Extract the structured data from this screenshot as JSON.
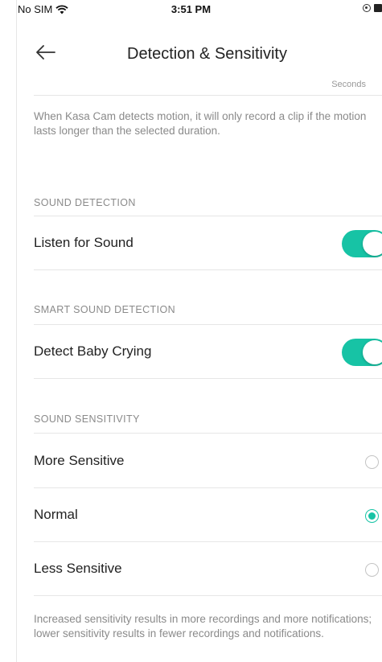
{
  "status_bar": {
    "carrier": "No SIM",
    "time": "3:51 PM",
    "wifi_icon": "wifi-icon",
    "lock_icon": "orientation-lock-icon",
    "battery_icon": "battery-icon"
  },
  "nav": {
    "back_icon": "back-arrow-icon",
    "title": "Detection & Sensitivity"
  },
  "motion_duration": {
    "unit_label": "Seconds",
    "description": "When Kasa Cam detects motion, it will only record a clip if the motion lasts longer than the selected duration."
  },
  "sound_detection": {
    "header": "SOUND DETECTION",
    "label": "Listen for Sound",
    "enabled": true
  },
  "smart_sound_detection": {
    "header": "SMART SOUND DETECTION",
    "label": "Detect Baby Crying",
    "enabled": true
  },
  "sound_sensitivity": {
    "header": "SOUND SENSITIVITY",
    "options": [
      {
        "label": "More Sensitive",
        "selected": false
      },
      {
        "label": "Normal",
        "selected": true
      },
      {
        "label": "Less Sensitive",
        "selected": false
      }
    ],
    "note": "Increased sensitivity results in more recordings and more notifications; lower sensitivity results in fewer recordings and notifications."
  },
  "colors": {
    "accent": "#17c3a5",
    "text": "#222222",
    "muted": "#8a8a8a",
    "divider": "#e6e6e6"
  }
}
